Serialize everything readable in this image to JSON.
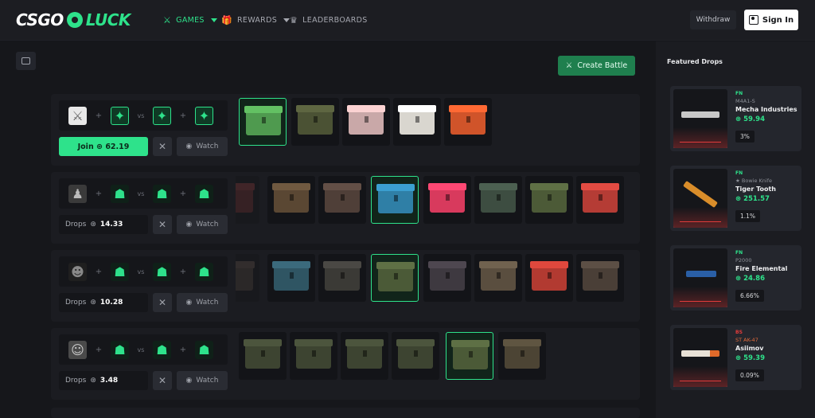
{
  "header": {
    "logo_left": "CSGO",
    "logo_right": "LUCK",
    "nav": {
      "games": "GAMES",
      "rewards": "REWARDS",
      "leaderboards": "LEADERBOARDS"
    },
    "withdraw": "Withdraw",
    "signin": "Sign In"
  },
  "main": {
    "create_battle": "Create Battle",
    "vs": "vs",
    "plus": "+",
    "watch": "Watch",
    "drops_label": "Drops",
    "battles": [
      {
        "action": "Join",
        "value": "62.19"
      },
      {
        "value": "14.33"
      },
      {
        "value": "10.28"
      },
      {
        "value": "3.48"
      }
    ]
  },
  "sidebar": {
    "title": "Featured Drops",
    "drops": [
      {
        "grade": "FN",
        "weapon": "M4A1-S",
        "skin": "Mecha Industries",
        "price": "59.94",
        "pct": "3%"
      },
      {
        "grade": "FN",
        "weapon": "★ Bowie Knife",
        "skin": "Tiger Tooth",
        "price": "251.57",
        "pct": "1.1%"
      },
      {
        "grade": "FN",
        "weapon": "P2000",
        "skin": "Fire Elemental",
        "price": "24.86",
        "pct": "6.66%"
      },
      {
        "grade": "BS",
        "weapon": "ST AK-47",
        "skin": "Asiimov",
        "price": "59.39",
        "pct": "0.09%"
      }
    ]
  },
  "colors": {
    "accent": "#2ee28b",
    "background": "#16171b",
    "red": "#e23b3b"
  }
}
